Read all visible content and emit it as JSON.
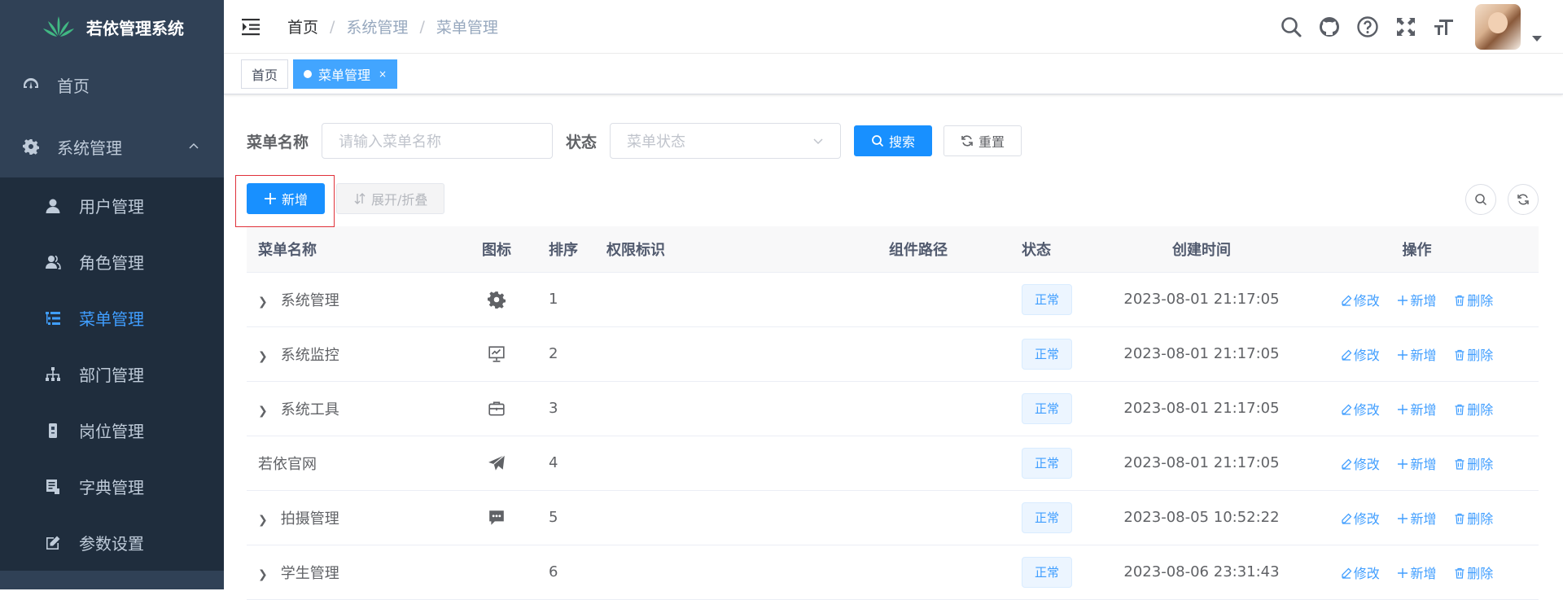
{
  "app": {
    "title": "若依管理系统"
  },
  "sidebar": {
    "home": "首页",
    "system": "系统管理",
    "items": [
      {
        "label": "用户管理",
        "icon": "user-icon"
      },
      {
        "label": "角色管理",
        "icon": "peoples-icon"
      },
      {
        "label": "菜单管理",
        "icon": "tree-table-icon",
        "active": true
      },
      {
        "label": "部门管理",
        "icon": "tree-icon"
      },
      {
        "label": "岗位管理",
        "icon": "post-icon"
      },
      {
        "label": "字典管理",
        "icon": "dict-icon"
      },
      {
        "label": "参数设置",
        "icon": "edit-icon"
      }
    ]
  },
  "breadcrumb": [
    "首页",
    "系统管理",
    "菜单管理"
  ],
  "tags": {
    "home": "首页",
    "current": "菜单管理",
    "close": "×"
  },
  "search": {
    "name_label": "菜单名称",
    "name_placeholder": "请输入菜单名称",
    "status_label": "状态",
    "status_placeholder": "菜单状态",
    "search_button": "搜索",
    "reset_button": "重置"
  },
  "toolbar": {
    "add_button": "新增",
    "toggle_button": "展开/折叠"
  },
  "table": {
    "headers": [
      "菜单名称",
      "图标",
      "排序",
      "权限标识",
      "组件路径",
      "状态",
      "创建时间",
      "操作"
    ],
    "rows": [
      {
        "name": "系统管理",
        "expandable": true,
        "icon": "system-icon",
        "sort": "1",
        "perm": "",
        "path": "",
        "status": "正常",
        "time": "2023-08-01 21:17:05"
      },
      {
        "name": "系统监控",
        "expandable": true,
        "icon": "monitor-icon",
        "sort": "2",
        "perm": "",
        "path": "",
        "status": "正常",
        "time": "2023-08-01 21:17:05"
      },
      {
        "name": "系统工具",
        "expandable": true,
        "icon": "tool-icon",
        "sort": "3",
        "perm": "",
        "path": "",
        "status": "正常",
        "time": "2023-08-01 21:17:05"
      },
      {
        "name": "若依官网",
        "expandable": false,
        "icon": "guide-icon",
        "sort": "4",
        "perm": "",
        "path": "",
        "status": "正常",
        "time": "2023-08-01 21:17:05"
      },
      {
        "name": "拍摄管理",
        "expandable": true,
        "icon": "message-icon",
        "sort": "5",
        "perm": "",
        "path": "",
        "status": "正常",
        "time": "2023-08-05 10:52:22"
      },
      {
        "name": "学生管理",
        "expandable": true,
        "icon": "",
        "sort": "6",
        "perm": "",
        "path": "",
        "status": "正常",
        "time": "2023-08-06 23:31:43"
      }
    ],
    "ops": {
      "edit": "修改",
      "add": "新增",
      "delete": "删除"
    }
  },
  "colors": {
    "sidebar_bg": "#304156",
    "submenu_bg": "#1f2d3d",
    "primary": "#1890ff",
    "active": "#409eff"
  }
}
